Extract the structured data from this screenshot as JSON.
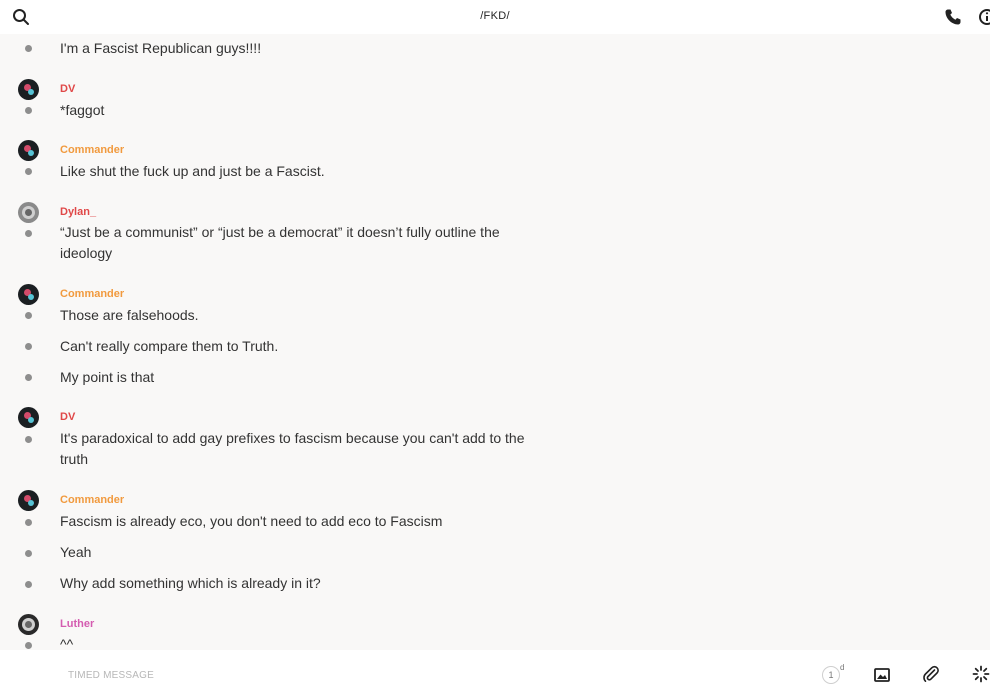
{
  "header": {
    "title": "/FKD/"
  },
  "colors": {
    "dv": "#e04848",
    "commander": "#f19a3e",
    "dylan": "#e04848",
    "luther": "#d45cb0"
  },
  "icons": {
    "search": "search-icon",
    "phone": "phone-icon",
    "info": "info-icon",
    "image": "image-icon",
    "attach": "paperclip-icon",
    "gif": "sparkle-icon",
    "timer": "timer-icon"
  },
  "messages": [
    {
      "text": "I'm a Fascist Republican guys!!!!"
    },
    {
      "sender": "DV",
      "text": "*faggot"
    },
    {
      "sender": "Commander",
      "text": "Like shut the fuck up and just be a Fascist."
    },
    {
      "sender": "Dylan_",
      "text": "“Just be a communist” or “just be a democrat” it doesn’t fully outline the ideology"
    },
    {
      "sender": "Commander",
      "text": "Those are falsehoods."
    },
    {
      "text": "Can't really compare them to Truth."
    },
    {
      "text": "My point is that"
    },
    {
      "sender": "DV",
      "text": "It's paradoxical to add gay prefixes to fascism because you can't add to the truth"
    },
    {
      "sender": "Commander",
      "text": "Fascism is already eco, you don't need to add eco to Fascism"
    },
    {
      "text": "Yeah"
    },
    {
      "text": "Why add something which is already in it?"
    },
    {
      "sender": "Luther",
      "text": "^^"
    }
  ],
  "composer": {
    "placeholder": "TIMED MESSAGE",
    "timer_value": "1",
    "timer_unit": "d"
  }
}
